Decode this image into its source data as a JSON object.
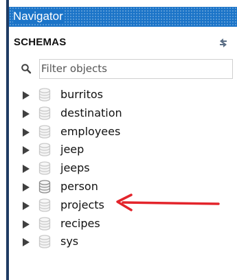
{
  "navigator": {
    "title": "Navigator",
    "section_title": "SCHEMAS",
    "refresh_icon": "refresh-icon"
  },
  "filter": {
    "placeholder": "Filter objects",
    "value": ""
  },
  "schemas": [
    {
      "name": "burritos"
    },
    {
      "name": "destination"
    },
    {
      "name": "employees"
    },
    {
      "name": "jeep"
    },
    {
      "name": "jeeps"
    },
    {
      "name": "person"
    },
    {
      "name": "projects"
    },
    {
      "name": "recipes"
    },
    {
      "name": "sys"
    }
  ],
  "colors": {
    "titlebar": "#1b74c8",
    "annotation_arrow": "#e3242b",
    "db_icon": "#c9c9c9",
    "db_icon_active": "#8c8c8c"
  }
}
